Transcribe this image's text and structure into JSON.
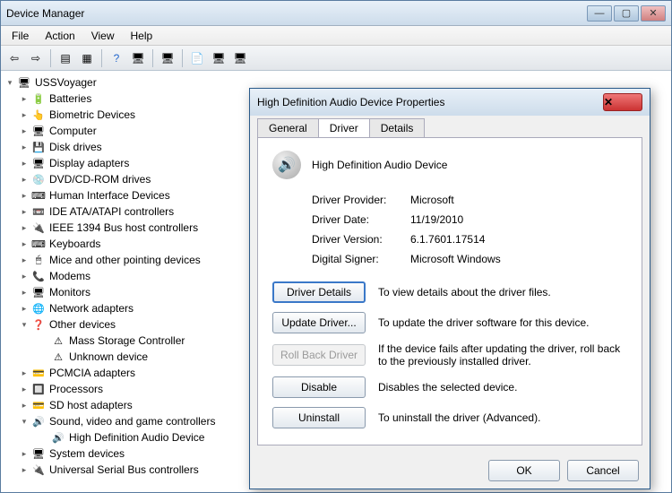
{
  "window": {
    "title": "Device Manager",
    "menu": [
      "File",
      "Action",
      "View",
      "Help"
    ]
  },
  "tree": {
    "root": "USSVoyager",
    "nodes": [
      {
        "label": "Batteries",
        "icon": "🔋"
      },
      {
        "label": "Biometric Devices",
        "icon": "👆"
      },
      {
        "label": "Computer",
        "icon": "🖥"
      },
      {
        "label": "Disk drives",
        "icon": "💾"
      },
      {
        "label": "Display adapters",
        "icon": "🖥"
      },
      {
        "label": "DVD/CD-ROM drives",
        "icon": "💿"
      },
      {
        "label": "Human Interface Devices",
        "icon": "⌨"
      },
      {
        "label": "IDE ATA/ATAPI controllers",
        "icon": "📼"
      },
      {
        "label": "IEEE 1394 Bus host controllers",
        "icon": "🔌"
      },
      {
        "label": "Keyboards",
        "icon": "⌨"
      },
      {
        "label": "Mice and other pointing devices",
        "icon": "🖱"
      },
      {
        "label": "Modems",
        "icon": "📞"
      },
      {
        "label": "Monitors",
        "icon": "🖥"
      },
      {
        "label": "Network adapters",
        "icon": "🌐"
      },
      {
        "label": "Other devices",
        "icon": "❓",
        "expanded": true,
        "children": [
          {
            "label": "Mass Storage Controller",
            "icon": "⚠",
            "warn": true
          },
          {
            "label": "Unknown device",
            "icon": "⚠",
            "warn": true
          }
        ]
      },
      {
        "label": "PCMCIA adapters",
        "icon": "💳"
      },
      {
        "label": "Processors",
        "icon": "🔲"
      },
      {
        "label": "SD host adapters",
        "icon": "💳"
      },
      {
        "label": "Sound, video and game controllers",
        "icon": "🔊",
        "expanded": true,
        "children": [
          {
            "label": "High Definition Audio Device",
            "icon": "🔊"
          }
        ]
      },
      {
        "label": "System devices",
        "icon": "🖥"
      },
      {
        "label": "Universal Serial Bus controllers",
        "icon": "🔌"
      }
    ]
  },
  "dialog": {
    "title": "High Definition Audio Device Properties",
    "tabs": [
      "General",
      "Driver",
      "Details"
    ],
    "activeTab": 1,
    "device_name": "High Definition Audio Device",
    "props": {
      "provider_k": "Driver Provider:",
      "provider_v": "Microsoft",
      "date_k": "Driver Date:",
      "date_v": "11/19/2010",
      "version_k": "Driver Version:",
      "version_v": "6.1.7601.17514",
      "signer_k": "Digital Signer:",
      "signer_v": "Microsoft Windows"
    },
    "actions": {
      "details_btn": "Driver Details",
      "details_desc": "To view details about the driver files.",
      "update_btn": "Update Driver...",
      "update_desc": "To update the driver software for this device.",
      "rollback_btn": "Roll Back Driver",
      "rollback_desc": "If the device fails after updating the driver, roll back to the previously installed driver.",
      "disable_btn": "Disable",
      "disable_desc": "Disables the selected device.",
      "uninstall_btn": "Uninstall",
      "uninstall_desc": "To uninstall the driver (Advanced)."
    },
    "ok": "OK",
    "cancel": "Cancel"
  }
}
